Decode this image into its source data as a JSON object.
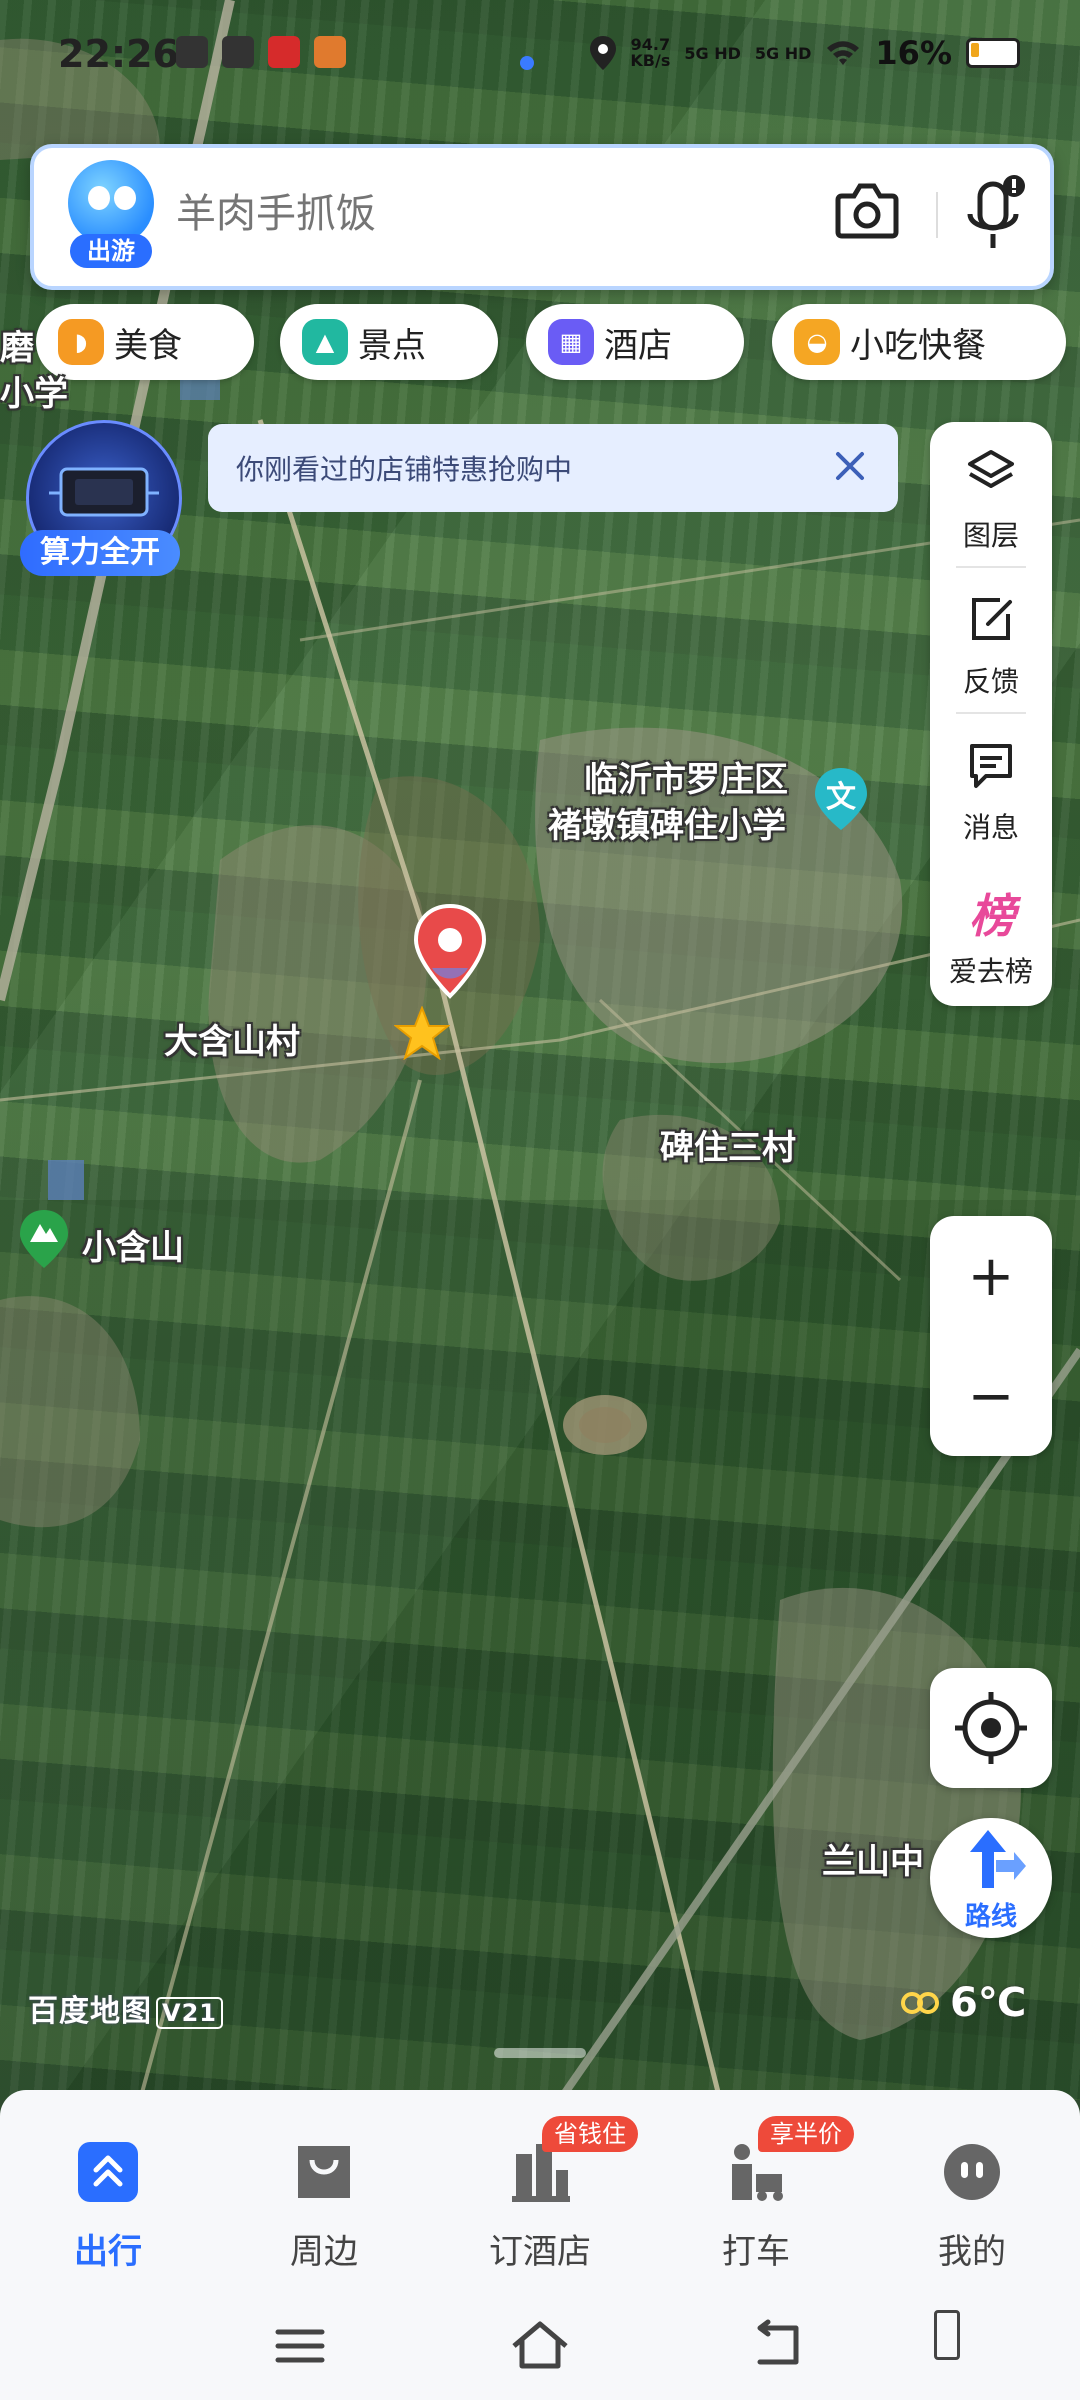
{
  "status": {
    "time": "22:26",
    "speed": "94.7\nKB/s",
    "sig1": "5G HD",
    "sig2": "5G HD",
    "battery": "16%"
  },
  "search": {
    "placeholder": "羊肉手抓饭",
    "mascot_tag": "出游"
  },
  "chips": [
    {
      "label": "美食",
      "color": "#f59a23"
    },
    {
      "label": "景点",
      "color": "#21b8a0"
    },
    {
      "label": "酒店",
      "color": "#6a5cf5"
    },
    {
      "label": "小吃快餐",
      "color": "#f5a623"
    }
  ],
  "promo": {
    "label": "算力全开"
  },
  "notice": {
    "text": "你刚看过的店铺特惠抢购中"
  },
  "side_panel": [
    {
      "label": "图层",
      "icon": "layers-icon"
    },
    {
      "label": "反馈",
      "icon": "feedback-icon"
    },
    {
      "label": "消息",
      "icon": "message-icon"
    },
    {
      "label": "爱去榜",
      "icon": "ranking-icon",
      "glyph": "榜"
    }
  ],
  "zoom": {
    "in": "+",
    "out": "−"
  },
  "route": {
    "label": "路线"
  },
  "map_labels": {
    "edge_1": "磨",
    "edge_2": "小学",
    "school_line1": "临沂市罗庄区",
    "school_line2": "褚墩镇碑住小学",
    "school_badge": "文",
    "village_1": "大含山村",
    "village_2": "碑住三村",
    "mountain": "小含山",
    "school_2": "兰山中"
  },
  "logo": {
    "text": "百度地图",
    "version": "V21"
  },
  "weather": {
    "temp": "6℃"
  },
  "tabs": [
    {
      "label": "出行",
      "active": true
    },
    {
      "label": "周边"
    },
    {
      "label": "订酒店",
      "badge": "省钱住"
    },
    {
      "label": "打车",
      "badge": "享半价"
    },
    {
      "label": "我的"
    }
  ]
}
